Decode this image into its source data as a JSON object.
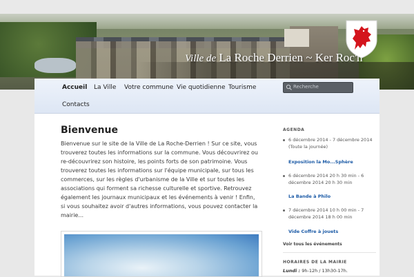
{
  "site": {
    "title_prefix": "Ville de",
    "title_main": "La Roche Derrien",
    "title_sep": "~",
    "title_breton": "Ker Roc'h"
  },
  "nav": {
    "items": [
      {
        "label": "Accueil",
        "active": true
      },
      {
        "label": "La Ville"
      },
      {
        "label": "Votre commune"
      },
      {
        "label": "Vie quotidienne"
      },
      {
        "label": "Tourisme"
      },
      {
        "label": "Contacts"
      }
    ],
    "search_placeholder": "Recherche"
  },
  "main": {
    "title": "Bienvenue",
    "intro": "Bienvenue sur le site de la Ville de La Roche-Derrien ! Sur ce site, vous trouverez toutes les informations sur la commune. Vous découvrirez ou re-découvrirez son histoire, les points forts de son patrimoine. Vous trouverez toutes les informations sur l'équipe municipale, sur tous les commerces, sur les règles d'urbanisme de la Ville et sur toutes les associations qui forment sa richesse culturelle et sportive. Retrouvez également les journaux municipaux et les événements à venir ! Enfin, si vous souhaitez avoir d'autres informations, vous pouvez contacter la mairie..."
  },
  "sidebar": {
    "agenda_heading": "AGENDA",
    "events": [
      {
        "date": "6 décembre 2014 - 7 décembre 2014 (Toute la journée)",
        "title": "Exposition la Mo...Sphère"
      },
      {
        "date": "6 décembre 2014 20 h 30 min - 6 décembre 2014 20 h 30 min",
        "title": "La Bande à Philo"
      },
      {
        "date": "7 décembre 2014 10 h 00 min - 7 décembre 2014 18 h 00 min",
        "title": "Vide Coffre à jouets"
      }
    ],
    "all_events": "Voir tous les événements",
    "hours_heading": "HORAIRES DE LA MAIRIE",
    "hours_day": "Lundi :",
    "hours_value": "9h-12h / 13h30-17h."
  },
  "colors": {
    "link": "#1b5aa6",
    "nav_bg": "#e3eaf6",
    "search_bg": "#5b6066"
  }
}
